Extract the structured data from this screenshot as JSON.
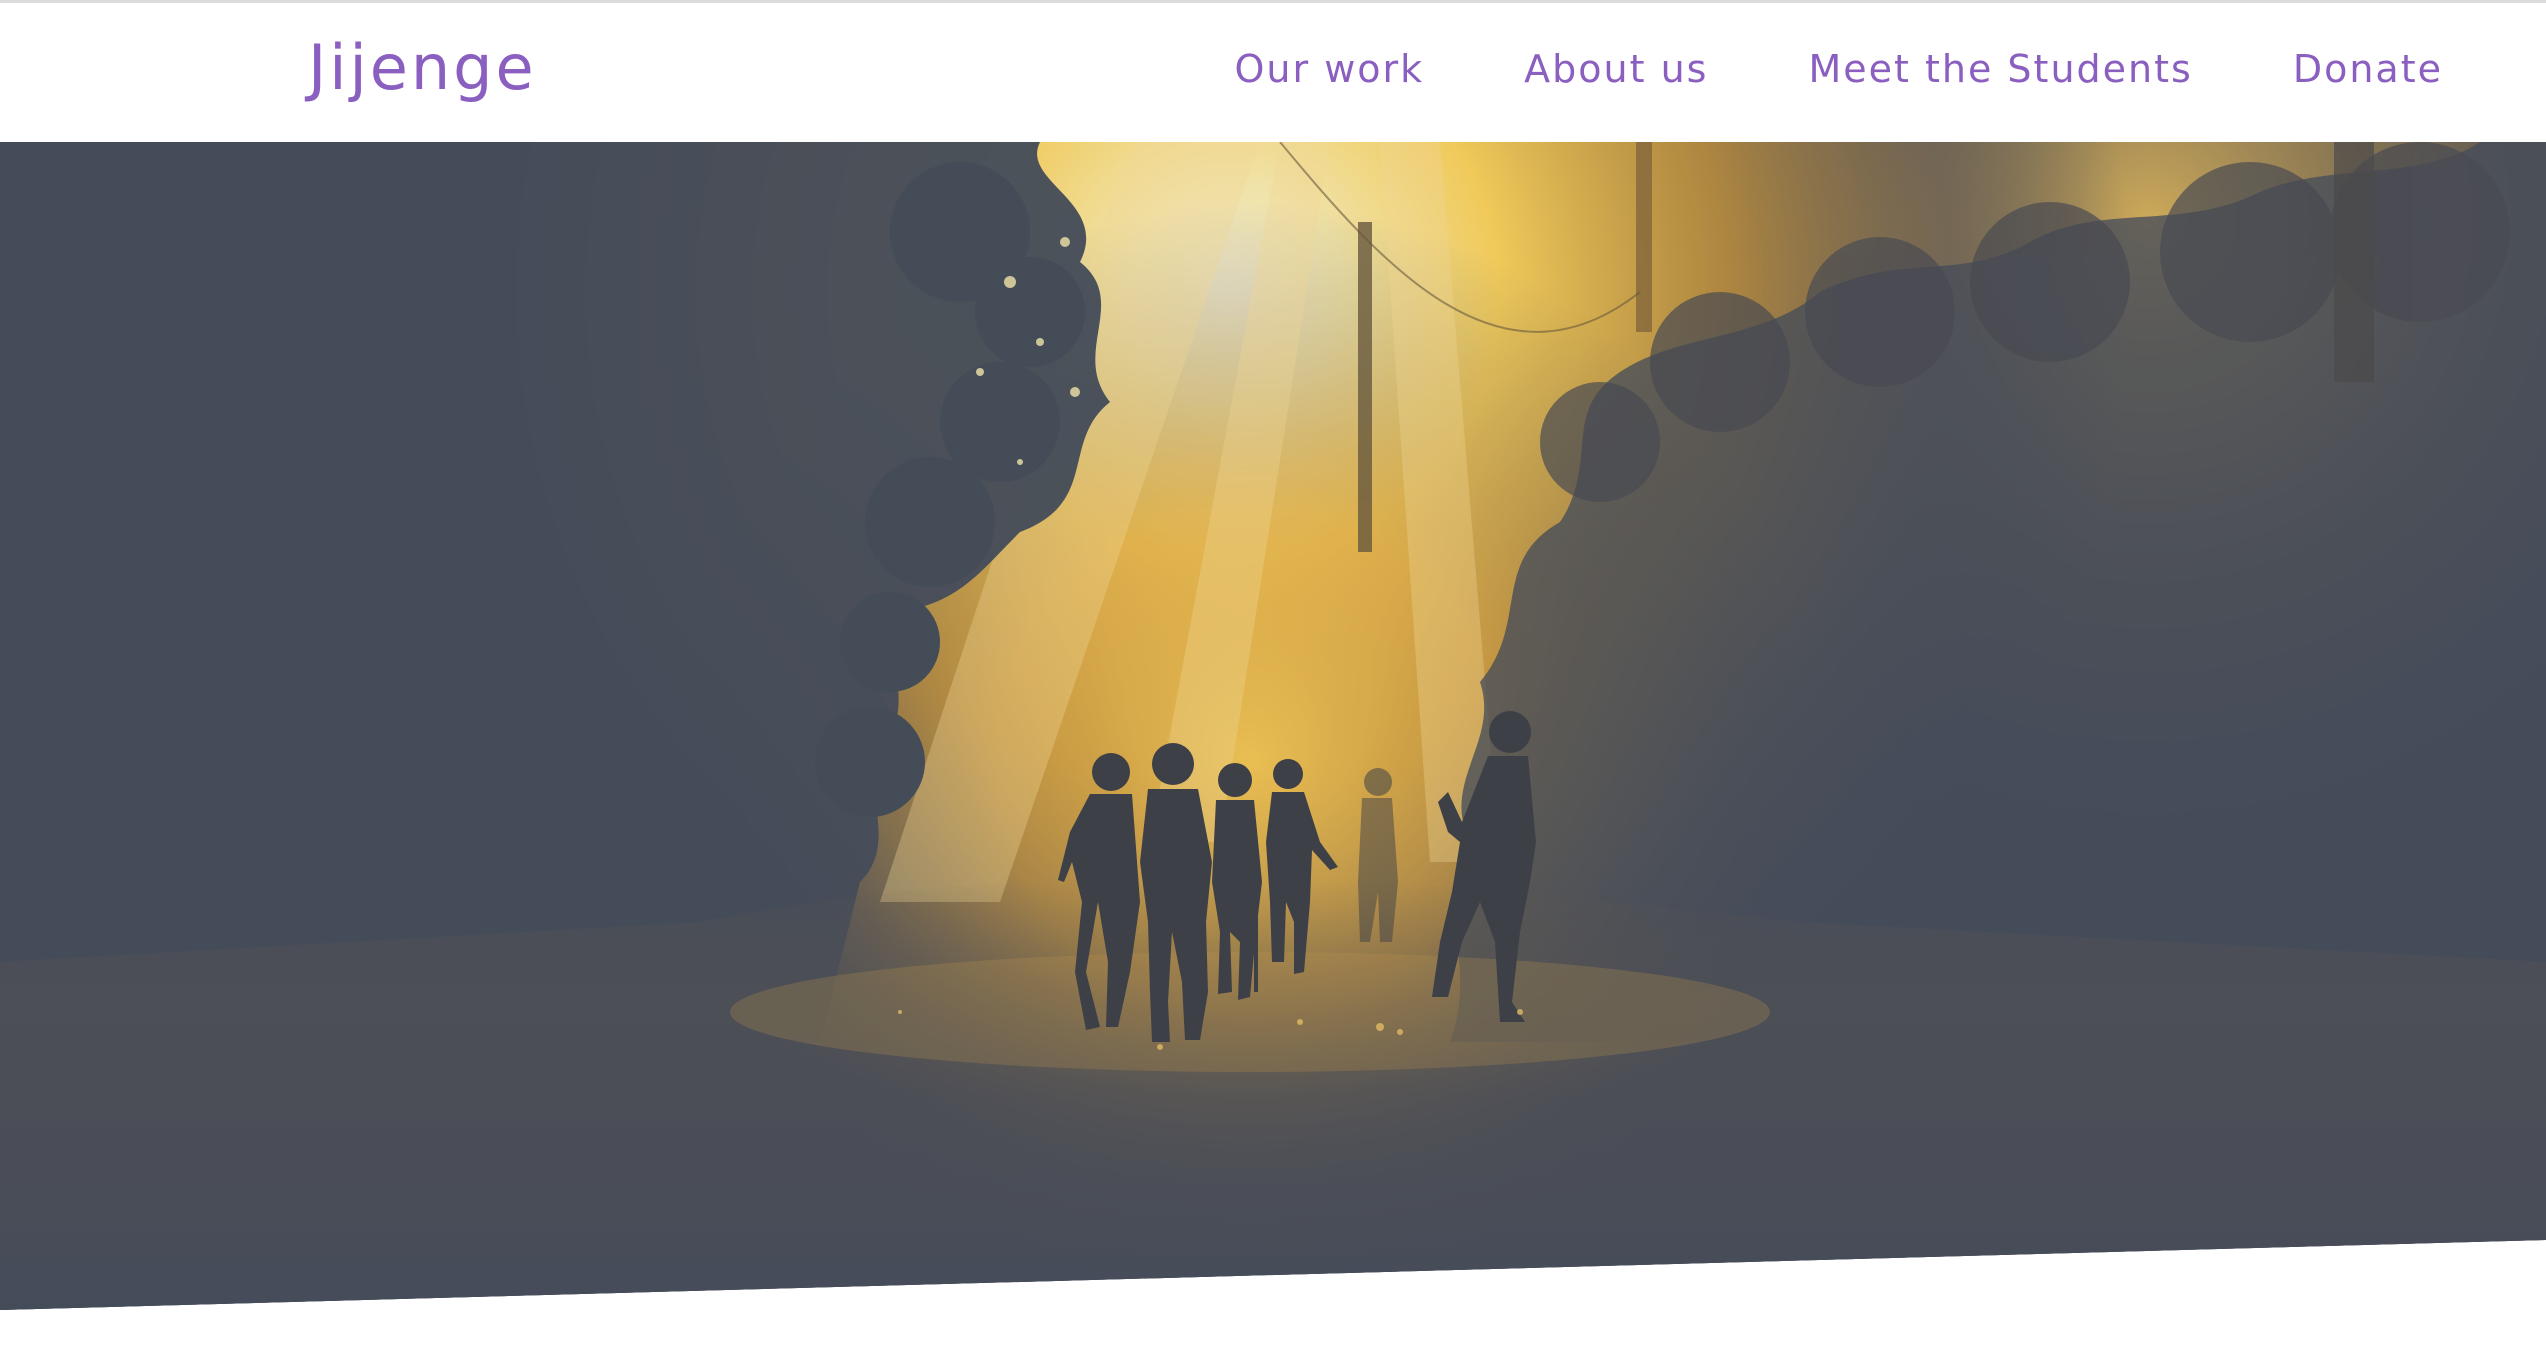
{
  "header": {
    "logo": "Jijenge",
    "nav": [
      {
        "label": "Our work"
      },
      {
        "label": "About us"
      },
      {
        "label": "Meet the Students"
      },
      {
        "label": "Donate"
      }
    ]
  },
  "hero": {
    "image": "children-running-sunlit-dirt-road-photo"
  },
  "colors": {
    "brand_purple": "#8a5fc0",
    "hero_overlay": "#464d5a",
    "sun_glow": "#ffd45a"
  }
}
